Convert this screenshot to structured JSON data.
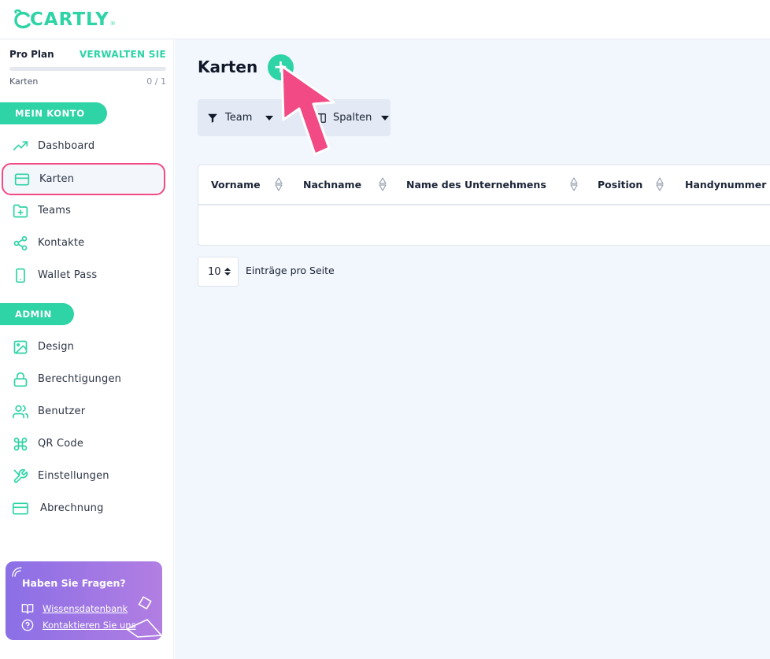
{
  "app": {
    "logo_text": "CARTLY",
    "logo_mark": "®",
    "brand_color": "#2ed3a6",
    "highlight_color": "#f24a84"
  },
  "sidebar": {
    "plan_name": "Pro Plan",
    "manage_label": "VERWALTEN SIE",
    "usage_label": "Karten",
    "usage_count": "0 / 1",
    "usage_fraction": 0,
    "sections": [
      {
        "title": "MEIN KONTO",
        "items": [
          {
            "label": "Dashboard",
            "icon": "trending-up-icon"
          },
          {
            "label": "Karten",
            "icon": "card-icon",
            "active": true
          },
          {
            "label": "Teams",
            "icon": "folder-plus-icon"
          },
          {
            "label": "Kontakte",
            "icon": "share-icon"
          },
          {
            "label": "Wallet Pass",
            "icon": "smartphone-icon"
          }
        ]
      },
      {
        "title": "ADMIN",
        "items": [
          {
            "label": "Design",
            "icon": "image-icon"
          },
          {
            "label": "Berechtigungen",
            "icon": "lock-icon"
          },
          {
            "label": "Benutzer",
            "icon": "users-icon"
          },
          {
            "label": "QR Code",
            "icon": "command-icon"
          },
          {
            "label": "Einstellungen",
            "icon": "tools-icon"
          },
          {
            "label": "Abrechnung",
            "icon": "credit-card-icon"
          }
        ]
      }
    ],
    "help": {
      "title": "Haben Sie Fragen?",
      "links": [
        {
          "label": "Wissensdatenbank",
          "icon": "book-icon"
        },
        {
          "label": "Kontaktieren Sie uns",
          "icon": "help-circle-icon"
        }
      ]
    }
  },
  "main": {
    "title": "Karten",
    "add_label": "+",
    "filters": [
      {
        "label": "Team",
        "icon": "filter-icon"
      },
      {
        "label": "Spalten",
        "icon": "columns-icon"
      }
    ],
    "table": {
      "columns": [
        "Vorname",
        "Nachname",
        "Name des Unternehmens",
        "Position",
        "Handynummer"
      ],
      "rows": []
    },
    "pagination": {
      "page_size": "10",
      "page_size_label": "Einträge pro Seite"
    }
  }
}
